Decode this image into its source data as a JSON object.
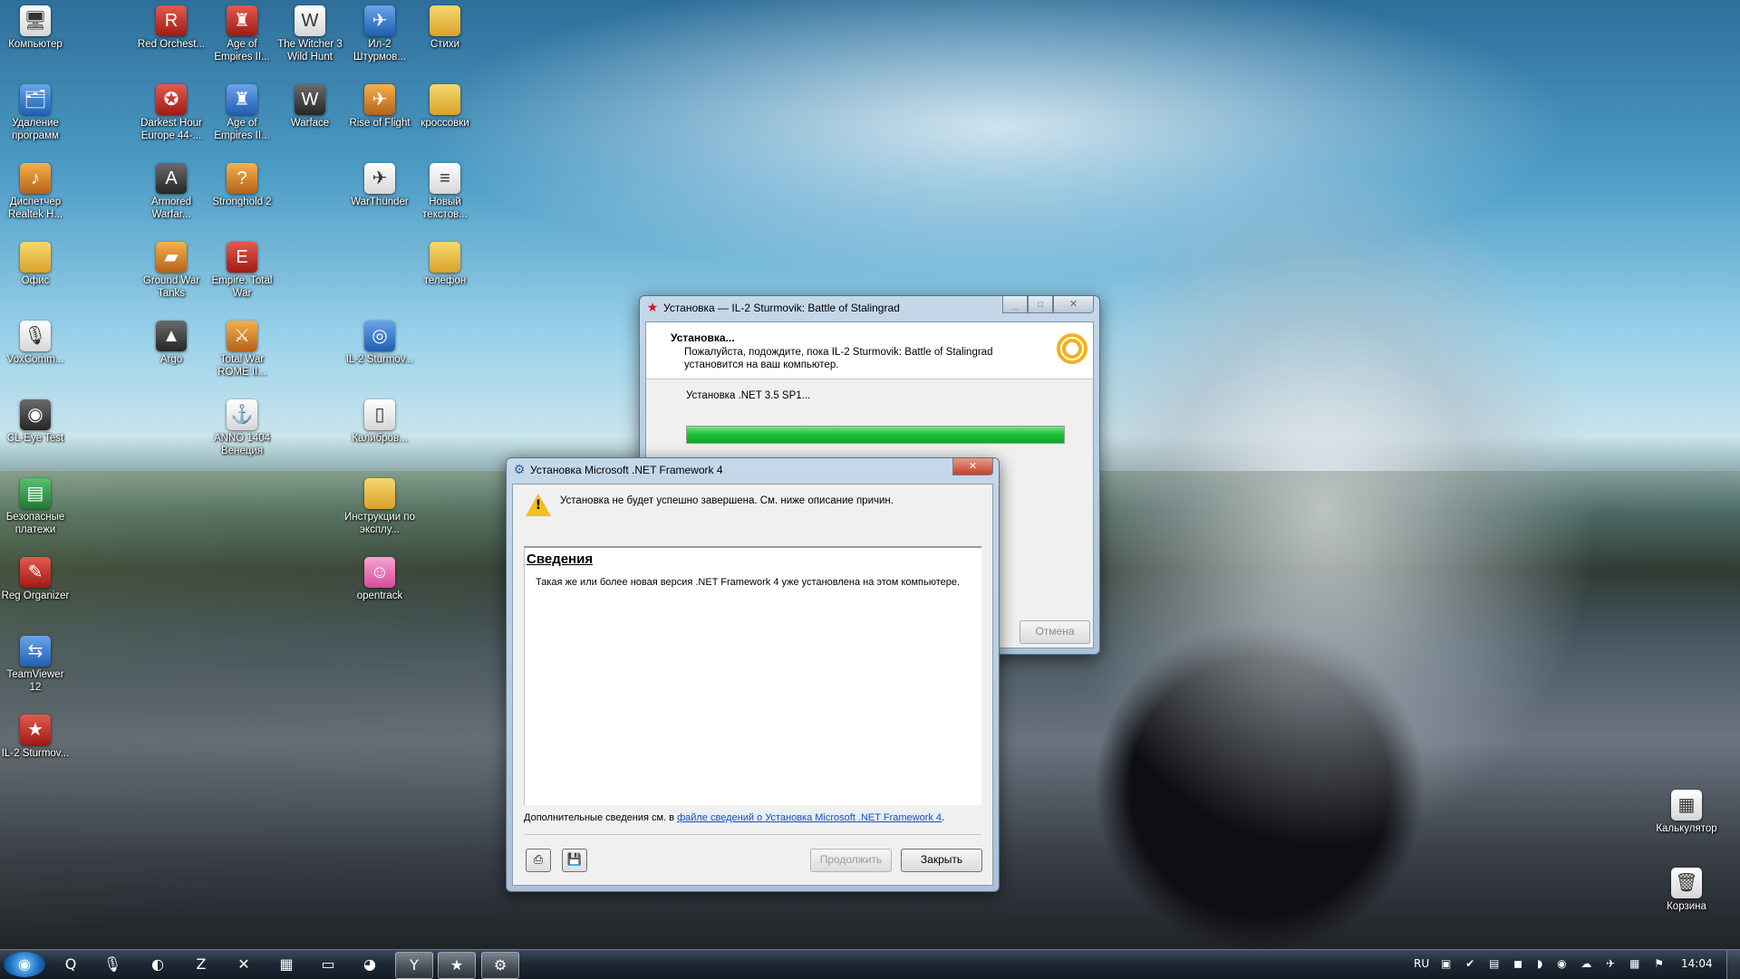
{
  "desktop_icons": [
    {
      "label": "Компьютер",
      "icon": "computer-icon",
      "glyph": "🖥",
      "cls": "g-white"
    },
    {
      "label": "Удаление программ",
      "icon": "uninstall-icon",
      "glyph": "🗂",
      "cls": "g-blue"
    },
    {
      "label": "Диспетчер Realtek H...",
      "icon": "realtek-icon",
      "glyph": "♪",
      "cls": "g-orange"
    },
    {
      "label": "Офис",
      "icon": "folder-icon",
      "glyph": "",
      "cls": "g-folder"
    },
    {
      "label": "VoxComm...",
      "icon": "microphone-icon",
      "glyph": "🎙",
      "cls": "g-white"
    },
    {
      "label": "CL-Eye Test",
      "icon": "camera-icon",
      "glyph": "◉",
      "cls": "g-dark"
    },
    {
      "label": "Безопасные платежи",
      "icon": "safe-payments-icon",
      "glyph": "▤",
      "cls": "g-green"
    },
    {
      "label": "Reg Organizer",
      "icon": "reg-organizer-icon",
      "glyph": "✎",
      "cls": "g-red"
    },
    {
      "label": "TeamViewer 12",
      "icon": "teamviewer-icon",
      "glyph": "⇆",
      "cls": "g-blue"
    },
    {
      "label": "IL-2 Sturmov...",
      "icon": "red-star-icon",
      "glyph": "★",
      "cls": "g-red"
    },
    {
      "label": "Red Orchest...",
      "icon": "game-icon",
      "glyph": "R",
      "cls": "g-red"
    },
    {
      "label": "Darkest Hour Europe 44-...",
      "icon": "game-icon",
      "glyph": "✪",
      "cls": "g-red"
    },
    {
      "label": "Armored Warfar...",
      "icon": "game-icon",
      "glyph": "A",
      "cls": "g-dark"
    },
    {
      "label": "Ground War Tanks",
      "icon": "game-icon",
      "glyph": "▰",
      "cls": "g-orange"
    },
    {
      "label": "Argo",
      "icon": "game-icon",
      "glyph": "▲",
      "cls": "g-dark"
    },
    {
      "label": "Age of Empires II...",
      "icon": "game-icon",
      "glyph": "♜",
      "cls": "g-red"
    },
    {
      "label": "Age of Empires II...",
      "icon": "game-icon",
      "glyph": "♜",
      "cls": "g-blue"
    },
    {
      "label": "Stronghold 2",
      "icon": "game-icon",
      "glyph": "?",
      "cls": "g-orange"
    },
    {
      "label": "Empire. Total War",
      "icon": "game-icon",
      "glyph": "E",
      "cls": "g-red"
    },
    {
      "label": "Total War ROME II...",
      "icon": "game-icon",
      "glyph": "⚔",
      "cls": "g-orange"
    },
    {
      "label": "ANNO 1404 Венеция",
      "icon": "game-icon",
      "glyph": "⚓",
      "cls": "g-white"
    },
    {
      "label": "The Witcher 3 Wild Hunt",
      "icon": "game-icon",
      "glyph": "W",
      "cls": "g-white"
    },
    {
      "label": "Warface",
      "icon": "game-icon",
      "glyph": "W",
      "cls": "g-dark"
    },
    {
      "label": "Ил-2 Штурмов...",
      "icon": "game-icon",
      "glyph": "✈",
      "cls": "g-blue"
    },
    {
      "label": "Rise of Flight",
      "icon": "game-icon",
      "glyph": "✈",
      "cls": "g-orange"
    },
    {
      "label": "WarThunder",
      "icon": "game-icon",
      "glyph": "✈",
      "cls": "g-white"
    },
    {
      "label": "IL-2 Sturmov...",
      "icon": "game-icon",
      "glyph": "◎",
      "cls": "g-blue"
    },
    {
      "label": "Калибров...",
      "icon": "document-icon",
      "glyph": "▯",
      "cls": "g-white"
    },
    {
      "label": "Инструкции по эксплу...",
      "icon": "folder-icon",
      "glyph": "",
      "cls": "g-folder"
    },
    {
      "label": "opentrack",
      "icon": "opentrack-icon",
      "glyph": "☺",
      "cls": "g-pink"
    },
    {
      "label": "Стихи",
      "icon": "folder-icon",
      "glyph": "",
      "cls": "g-folder"
    },
    {
      "label": "кроссовки",
      "icon": "folder-icon",
      "glyph": "",
      "cls": "g-folder"
    },
    {
      "label": "Новый текстов...",
      "icon": "text-file-icon",
      "glyph": "≡",
      "cls": "g-white"
    },
    {
      "label": "телефон",
      "icon": "folder-icon",
      "glyph": "",
      "cls": "g-folder"
    },
    {
      "label": "Калькулятор",
      "icon": "calculator-icon",
      "glyph": "▦",
      "cls": "g-white"
    },
    {
      "label": "Корзина",
      "icon": "recycle-bin-icon",
      "glyph": "🗑",
      "cls": "g-white"
    }
  ],
  "installer": {
    "title": "Установка — IL-2 Sturmovik: Battle of Stalingrad",
    "heading": "Установка...",
    "subtext_line1": "Пожалуйста, подождите, пока IL-2 Sturmovik: Battle of Stalingrad",
    "subtext_line2": "установится на ваш компьютер.",
    "status": "Установка .NET 3.5 SP1...",
    "progress": 1.0,
    "cancel_label": "Отмена",
    "progress_color": "#22c33a"
  },
  "netfx": {
    "title": "Установка Microsoft .NET Framework 4",
    "warning": "Установка не будет успешно завершена. См. ниже описание причин.",
    "details_heading": "Сведения",
    "details_text": "Такая же или более новая версия .NET Framework 4 уже установлена на этом компьютере.",
    "more_info_prefix": "Дополнительные сведения см. в",
    "more_info_link": "файле сведений о Установка Microsoft .NET Framework 4",
    "continue_label": "Продолжить",
    "close_label": "Закрыть"
  },
  "taskbar": {
    "language": "RU",
    "clock": "14:04",
    "items": [
      {
        "name": "start-orb",
        "glyph": "◉"
      },
      {
        "name": "search-app-icon",
        "glyph": "Q"
      },
      {
        "name": "voice-app-icon",
        "glyph": "🎙"
      },
      {
        "name": "arc-app-icon",
        "glyph": "◐"
      },
      {
        "name": "tool-app-icon",
        "glyph": "Z"
      },
      {
        "name": "x-app-icon",
        "glyph": "✕"
      },
      {
        "name": "calculator-app-icon",
        "glyph": "▦"
      },
      {
        "name": "chat-app-icon",
        "glyph": "▭"
      },
      {
        "name": "steam-app-icon",
        "glyph": "◕"
      },
      {
        "name": "yandex-browser-icon",
        "glyph": "Y"
      },
      {
        "name": "il2-taskbar-icon",
        "glyph": "★"
      },
      {
        "name": "installer-taskbar-icon",
        "glyph": "⚙"
      }
    ]
  }
}
